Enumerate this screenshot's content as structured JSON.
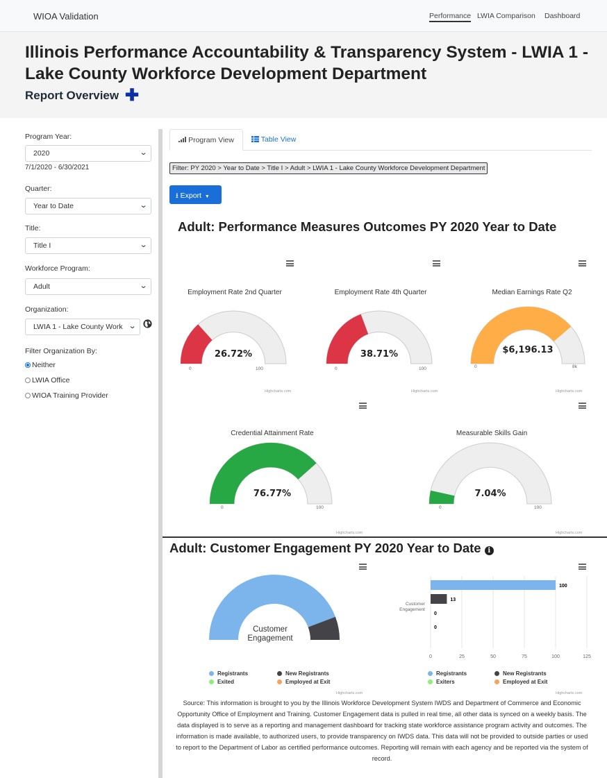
{
  "nav": {
    "brand": "WIOA Validation",
    "links": [
      "Performance",
      "LWIA Comparison",
      "Dashboard"
    ]
  },
  "header": {
    "title": "Illinois Performance Accountability & Transparency System - LWIA 1 - Lake County Workforce Development Department",
    "subtitle": "Report Overview",
    "plus": "✚"
  },
  "sidebar": {
    "program_year_label": "Program Year:",
    "program_year_value": "2020",
    "program_year_range": "7/1/2020 - 6/30/2021",
    "quarter_label": "Quarter:",
    "quarter_value": "Year to Date",
    "title_label": "Title:",
    "title_value": "Title I",
    "program_label": "Workforce Program:",
    "program_value": "Adult",
    "org_label": "Organization:",
    "org_value": "LWIA 1 - Lake County Work",
    "filter_label": "Filter Organization By:",
    "radios": [
      "Neither",
      "LWIA Office",
      "WIOA Training Provider"
    ],
    "radio_selected": "Neither"
  },
  "tabs": {
    "program_view": "Program View",
    "table_view": "Table View"
  },
  "filter_text": "Filter: PY 2020 > Year to Date > Title I > Adult > LWIA 1 - Lake County Workforce Development Department",
  "export_label": "Export",
  "colors": {
    "red": "#dc3545",
    "orange": "#ffad46",
    "green": "#28a745",
    "track": "#eeeeee",
    "blue": "#7cb5ec",
    "dark": "#434348",
    "lightgreen": "#90ed7d",
    "accent_orange": "#f7a35c"
  },
  "performance": {
    "title": "Adult: Performance Measures Outcomes PY 2020 Year to Date",
    "credit": "Highcharts.com",
    "gauges": [
      {
        "title": "Employment Rate 2nd Quarter",
        "value_text": "26.72%",
        "fraction": 0.2672,
        "min": "0",
        "max": "100",
        "color": "#dc3545"
      },
      {
        "title": "Employment Rate 4th Quarter",
        "value_text": "38.71%",
        "fraction": 0.3871,
        "min": "0",
        "max": "100",
        "color": "#dc3545"
      },
      {
        "title": "Median Earnings Rate Q2",
        "value_text": "$6,196.13",
        "fraction": 0.7745,
        "min": "0",
        "max": "8k",
        "color": "#ffad46"
      },
      {
        "title": "Credential Attainment Rate",
        "value_text": "76.77%",
        "fraction": 0.7677,
        "min": "0",
        "max": "100",
        "color": "#28a745"
      },
      {
        "title": "Measurable Skills Gain",
        "value_text": "7.04%",
        "fraction": 0.0704,
        "min": "0",
        "max": "100",
        "color": "#28a745"
      }
    ]
  },
  "engagement": {
    "title": "Adult: Customer Engagement PY 2020 Year to Date",
    "info": "i",
    "donut_label": "Customer Engagement",
    "legend_left": [
      "Registrants",
      "New Registrants",
      "Exited",
      "Employed at Exit"
    ],
    "legend_right": [
      "Registrants",
      "New Registrants",
      "Exiters",
      "Employed at Exit"
    ]
  },
  "chart_data": [
    {
      "type": "pie",
      "title": "Customer Engagement",
      "categories": [
        "Registrants",
        "New Registrants",
        "Exited",
        "Employed at Exit"
      ],
      "values": [
        100,
        13,
        0,
        0
      ]
    },
    {
      "type": "bar",
      "orientation": "horizontal",
      "categories": [
        "Customer Engagement"
      ],
      "series": [
        {
          "name": "Registrants",
          "values": [
            100
          ]
        },
        {
          "name": "New Registrants",
          "values": [
            13
          ]
        },
        {
          "name": "Exiters",
          "values": [
            0
          ]
        },
        {
          "name": "Employed at Exit",
          "values": [
            0
          ]
        }
      ],
      "xlim": [
        0,
        125
      ],
      "ticks": [
        "0",
        "25",
        "50",
        "75",
        "100",
        "125"
      ]
    }
  ],
  "source_text": "Source: This information is brought to you by the Illinois Workforce Development System IWDS and Department of Commerce and Economic Opportunity Office of Employment and Training. Customer Engagement data is pulled in real time, all other data is synced on a weekly basis. The data displayed is to serve as a reporting and management dashboard for tracking state workforce assistance program activity and outcomes. The information is made available, to authorized users, to provide transparency on IWDS data. This data will not be provided to outside parties or used to report to the Department of Labor as certified performance outcomes. Reporting will remain with each agency and be reported via the system of record."
}
